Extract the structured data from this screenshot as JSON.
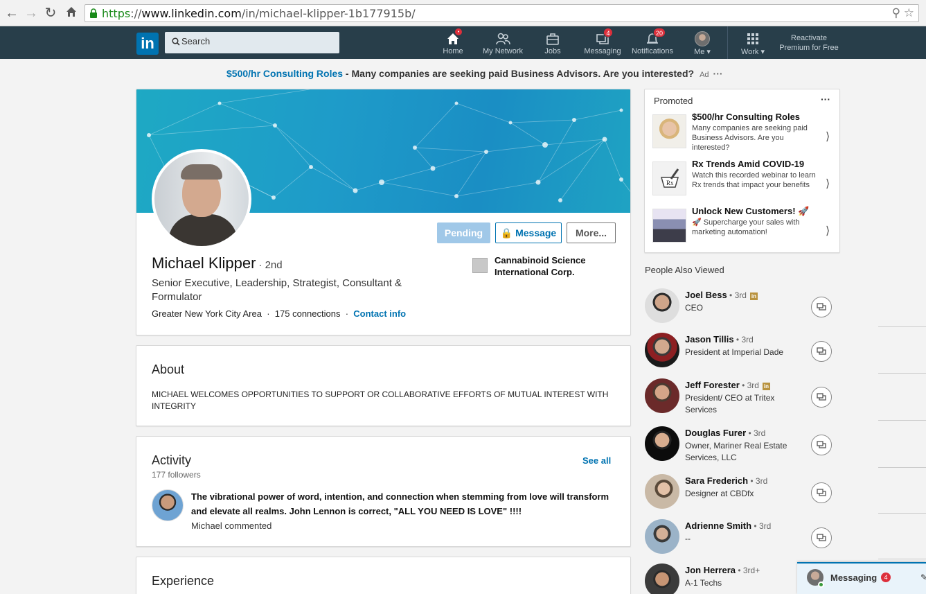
{
  "browser": {
    "url_scheme": "https",
    "url_host": "www.linkedin.com",
    "url_path": "/in/michael-klipper-1b177915b/"
  },
  "header": {
    "search_placeholder": "Search",
    "nav": [
      {
        "label": "Home",
        "badge": "•"
      },
      {
        "label": "My Network",
        "badge": ""
      },
      {
        "label": "Jobs",
        "badge": ""
      },
      {
        "label": "Messaging",
        "badge": "4"
      },
      {
        "label": "Notifications",
        "badge": "20"
      },
      {
        "label": "Me",
        "badge": ""
      },
      {
        "label": "Work",
        "badge": ""
      }
    ],
    "premium_line1": "Reactivate",
    "premium_line2": "Premium for Free"
  },
  "top_ad": {
    "link": "$500/hr Consulting Roles",
    "separator": " - ",
    "text": "Many companies are seeking paid Business Advisors. Are you interested?",
    "tag": "Ad",
    "more": "···"
  },
  "profile": {
    "name": "Michael Klipper",
    "degree": "· 2nd",
    "headline": "Senior Executive, Leadership, Strategist, Consultant & Formulator",
    "location": "Greater New York City Area",
    "connections": "175 connections",
    "contact": "Contact info",
    "sep": "·",
    "company": "Cannabinoid Science International Corp.",
    "buttons": {
      "pending": "Pending",
      "message": "Message",
      "more": "More..."
    }
  },
  "about": {
    "title": "About",
    "text": "MICHAEL WELCOMES OPPORTUNITIES TO SUPPORT OR COLLABORATIVE EFFORTS OF MUTUAL INTEREST WITH INTEGRITY"
  },
  "activity": {
    "title": "Activity",
    "followers": "177 followers",
    "see_all": "See all",
    "post_text": "The vibrational power of word, intention, and connection when stemming from love will transform and elevate all realms. John Lennon is correct, \"ALL YOU NEED IS LOVE\" !!!!",
    "post_sub": "Michael commented"
  },
  "experience": {
    "title": "Experience"
  },
  "promoted": {
    "title": "Promoted",
    "more": "···",
    "items": [
      {
        "head": "$500/hr Consulting Roles",
        "body": "Many companies are seeking paid Business Advisors. Are you interested?"
      },
      {
        "head": "Rx Trends Amid COVID-19",
        "body": "Watch this recorded webinar to learn Rx trends that impact your benefits"
      },
      {
        "head": "Unlock New Customers! 🚀",
        "body": "🚀 Supercharge your sales with marketing automation!"
      }
    ]
  },
  "people_also_viewed": {
    "title": "People Also Viewed",
    "items": [
      {
        "name": "Joel Bess",
        "degree": " • 3rd",
        "premium": true,
        "sub": "CEO"
      },
      {
        "name": "Jason Tillis",
        "degree": " • 3rd",
        "premium": false,
        "sub": "President at Imperial Dade"
      },
      {
        "name": "Jeff Forester",
        "degree": " • 3rd",
        "premium": true,
        "sub": "President/ CEO at Tritex Services"
      },
      {
        "name": "Douglas Furer",
        "degree": " • 3rd",
        "premium": false,
        "sub": "Owner, Mariner Real Estate Services, LLC"
      },
      {
        "name": "Sara Frederich",
        "degree": " • 3rd",
        "premium": false,
        "sub": "Designer at CBDfx"
      },
      {
        "name": "Adrienne Smith",
        "degree": " • 3rd",
        "premium": false,
        "sub": "--"
      },
      {
        "name": "Jon Herrera",
        "degree": " • 3rd+",
        "premium": false,
        "sub": "A-1 Techs"
      }
    ]
  },
  "messaging_bar": {
    "label": "Messaging",
    "badge": "4"
  },
  "colors": {
    "linkedin_blue": "#0073b1",
    "header_bg": "#283e4a",
    "badge_red": "#dd2f3b",
    "premium_gold": "#b9933f"
  }
}
